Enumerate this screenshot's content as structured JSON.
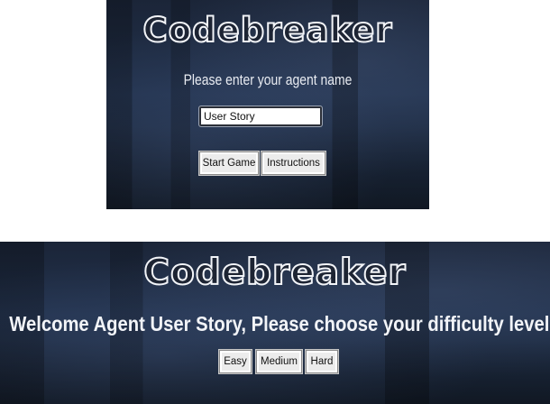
{
  "top_screen": {
    "logo": "Codebreaker",
    "prompt": "Please enter your agent name",
    "name_input_value": "User Story",
    "start_button": "Start Game",
    "instructions_button": "Instructions"
  },
  "bottom_screen": {
    "logo": "Codebreaker",
    "welcome": "Welcome Agent User Story, Please choose your difficulty level",
    "difficulty_buttons": [
      "Easy",
      "Medium",
      "Hard"
    ]
  }
}
